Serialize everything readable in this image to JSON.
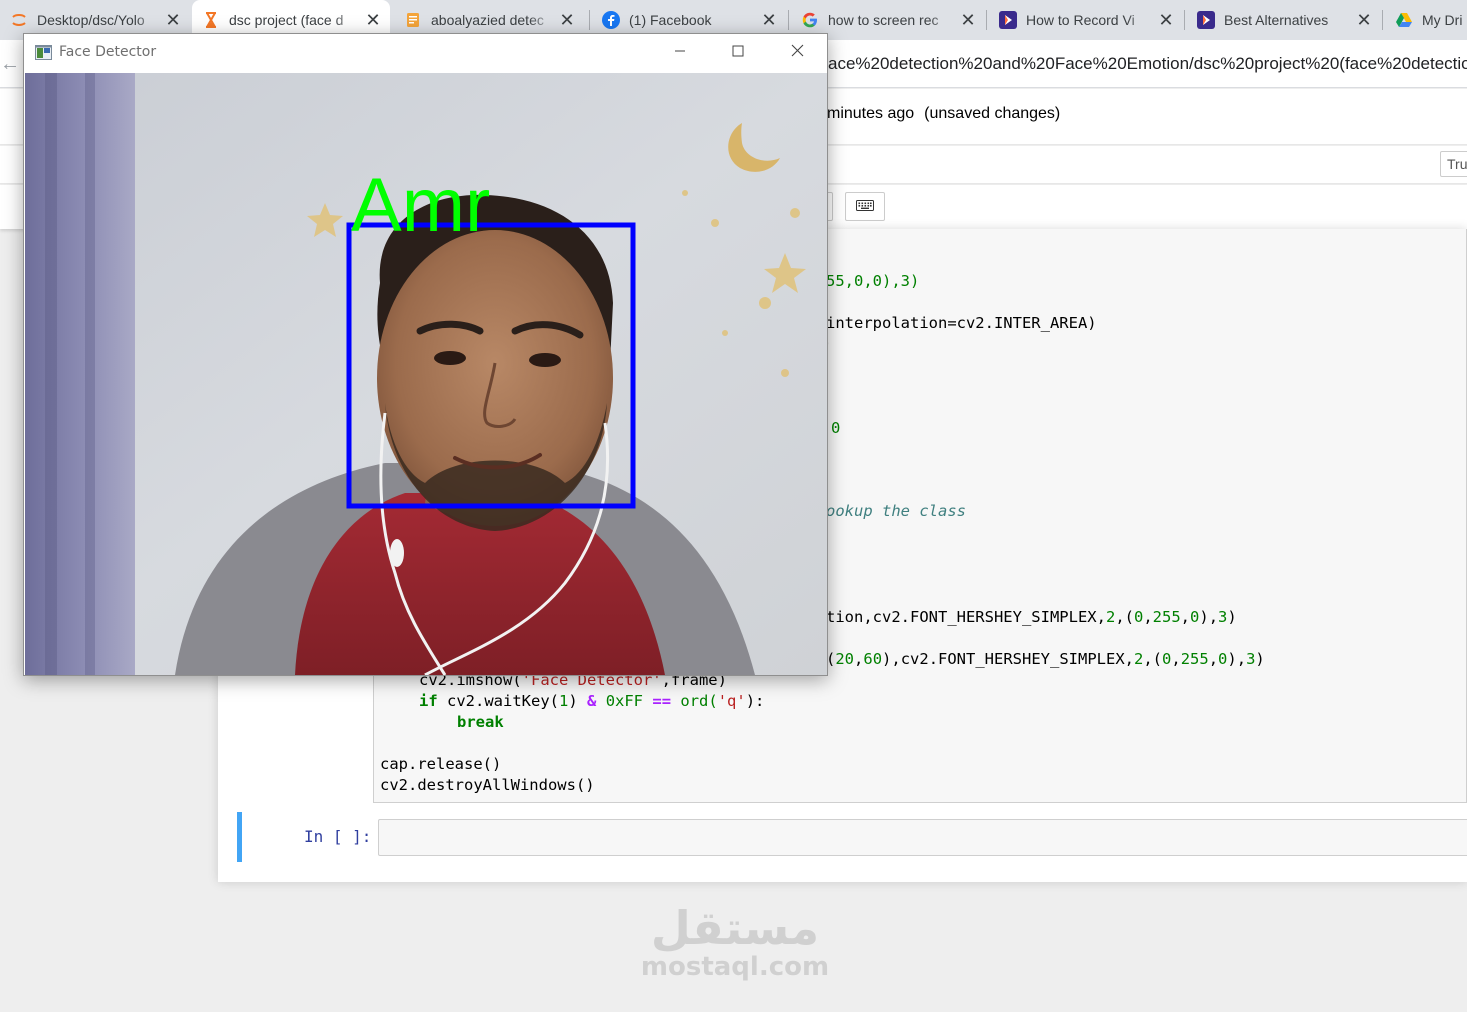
{
  "browser": {
    "tabs": [
      {
        "title": "Desktop/dsc/Yolo",
        "icon": "jupyter-icon"
      },
      {
        "title": "dsc project (face d",
        "icon": "hourglass-icon"
      },
      {
        "title": "aboalyazied detec",
        "icon": "document-icon"
      },
      {
        "title": "(1) Facebook",
        "icon": "facebook-icon"
      },
      {
        "title": "how to screen rec",
        "icon": "google-icon"
      },
      {
        "title": "How to Record Vi",
        "icon": "play-icon"
      },
      {
        "title": "Best Alternatives",
        "icon": "play-icon"
      },
      {
        "title": "My Dri",
        "icon": "google-drive-icon"
      }
    ],
    "url": "ace%20detection%20and%20Face%20Emotion/dsc%20project%20(face%20detection"
  },
  "notebook": {
    "save_status": "minutes ago",
    "unsaved": "(unsaved changes)",
    "trusted": "Tru",
    "empty_prompt": "In [ ]:"
  },
  "code_fragments": {
    "l1": "55,0,0),3)",
    "l2": "interpolation=cv2.INTER_AREA)",
    "l3": ")",
    "l4": "0",
    "l5": "ookup the class",
    "l6_a": "tion,cv2.FONT_HERSHEY_SIMPLEX,",
    "l6_b": "2",
    "l6_c": ",(",
    "l6_d": "0",
    "l6_e": ",",
    "l6_f": "255",
    "l6_g": "0",
    "l6_h": "3",
    "l7_a": "(",
    "l7_b": "20",
    "l7_c": "60",
    "l7_d": "),cv2.FONT_HERSHEY_SIMPLEX,"
  },
  "code_tail": {
    "imshow_a": "cv2.imshow(",
    "imshow_str": "'Face Detector'",
    "imshow_b": ",frame)",
    "if_kw": "if",
    "if_a": " cv2.waitKey(",
    "if_num1": "1",
    "if_b": ") ",
    "if_amp": "&",
    "if_hex": " 0xFF ",
    "if_eq": "==",
    "if_ord": " ord(",
    "if_str": "'q'",
    "if_end": "):",
    "break_kw": "break",
    "release": "cap.release()",
    "destroy": "cv2.destroyAllWindows()"
  },
  "face_window": {
    "title": "Face Detector",
    "label": "Amr",
    "box_color": "#0000ff",
    "label_color": "#00ff00"
  },
  "watermark": {
    "logo": "مستقل",
    "sub": "mostaql.com"
  }
}
